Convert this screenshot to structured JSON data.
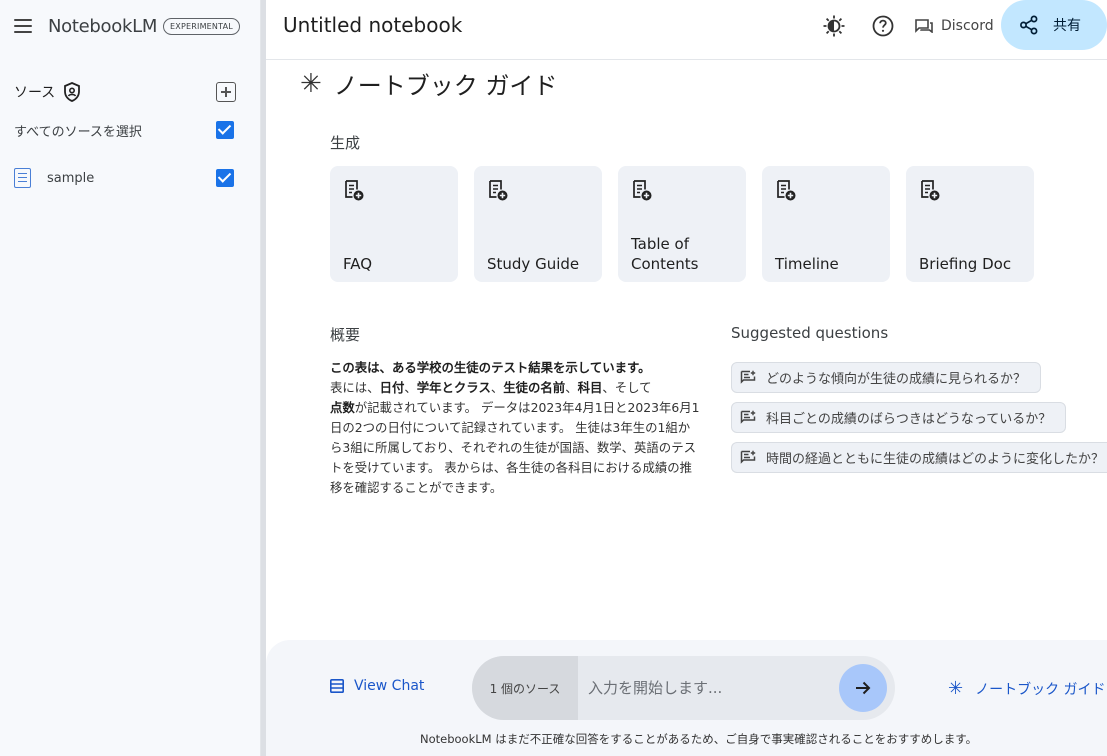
{
  "brand": {
    "name": "NotebookLM",
    "badge": "EXPERIMENTAL"
  },
  "sidebar": {
    "sources_label": "ソース",
    "select_all_label": "すべてのソースを選択",
    "items": [
      {
        "label": "sample",
        "checked": true
      }
    ]
  },
  "header": {
    "notebook_title": "Untitled notebook",
    "discord_label": "Discord",
    "share_label": "共有"
  },
  "guide": {
    "title": "ノートブック ガイド",
    "generate_label": "生成",
    "cards": [
      {
        "label": "FAQ"
      },
      {
        "label": "Study Guide"
      },
      {
        "label": "Table of\nContents"
      },
      {
        "label": "Timeline"
      },
      {
        "label": "Briefing Doc"
      }
    ],
    "summary_label": "概要",
    "summary": {
      "lead": "この表は、ある学校の生徒のテスト結果を示しています。",
      "p1": "表には、",
      "b1": "日付",
      "p2": "、",
      "b2": "学年とクラス",
      "p3": "、",
      "b3": "生徒の名前",
      "p4": "、",
      "b4": "科目",
      "p5": "、そして",
      "b5": "点数",
      "p6": "が記載されています。 データは2023年4月1日と2023年6月1日の2つの日付について記録されています。 生徒は3年生の1組から3組に所属しており、それぞれの生徒が国語、数学、英語のテストを受けています。 表からは、各生徒の各科目における成績の推移を確認することができます。"
    },
    "suggested_label": "Suggested questions",
    "questions": [
      "どのような傾向が生徒の成績に見られるか？",
      "科目ごとの成績のばらつきはどうなっているか？",
      "時間の経過とともに生徒の成績はどのように変化したか？"
    ]
  },
  "bottom": {
    "view_chat": "View Chat",
    "source_count": "1 個のソース",
    "input_placeholder": "入力を開始します...",
    "guide_link": "ノートブック ガイド",
    "disclaimer": "NotebookLM はまだ不正確な回答をすることがあるため、ご自身で事実確認されることをおすすめします。"
  },
  "colors": {
    "accent": "#1a73e8",
    "share_bg": "#c2e7ff",
    "card_bg": "#eef1f6",
    "sidebar_bg": "#f7f9fc",
    "send_bg": "#a8c7fa"
  },
  "icons": [
    "menu-icon",
    "shield-icon",
    "add-source-icon",
    "doc-icon",
    "theme-icon",
    "help-icon",
    "chat-icon",
    "share-icon",
    "sparkle-icon",
    "note-add-icon",
    "question-icon",
    "view-chat-icon",
    "send-icon"
  ]
}
